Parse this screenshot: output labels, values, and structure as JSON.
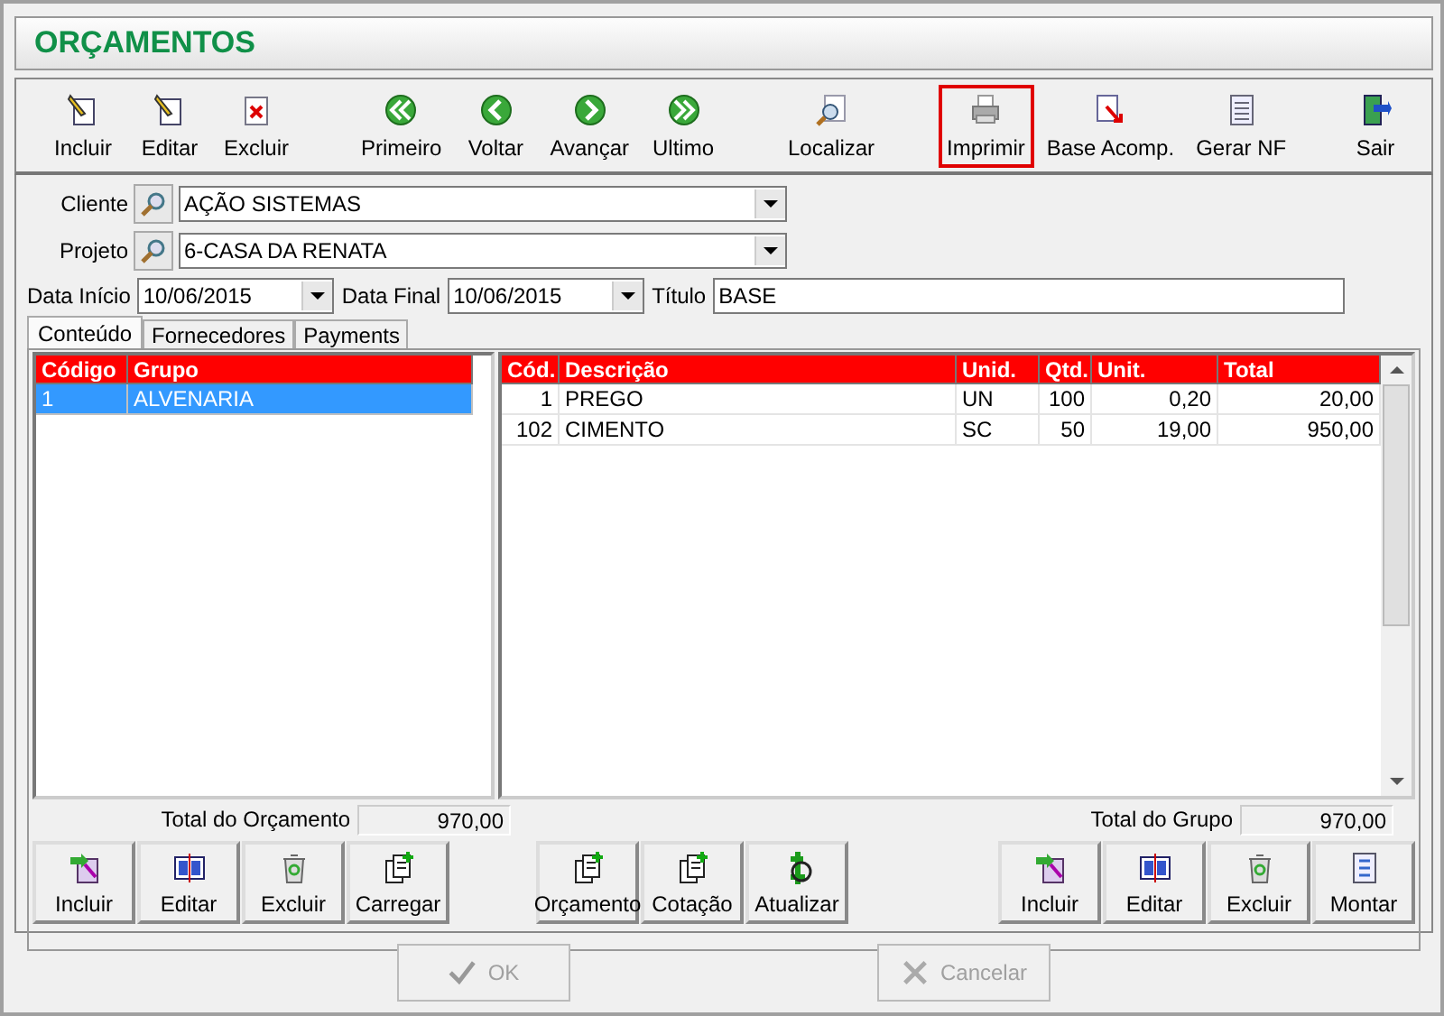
{
  "window": {
    "title": "ORÇAMENTOS"
  },
  "toolbar": [
    [
      {
        "label": "Incluir",
        "highlighted": false
      },
      {
        "label": "Editar",
        "highlighted": false
      },
      {
        "label": "Excluir",
        "highlighted": false
      }
    ],
    [
      {
        "label": "Primeiro",
        "highlighted": false
      },
      {
        "label": "Voltar",
        "highlighted": false
      },
      {
        "label": "Avançar",
        "highlighted": false
      },
      {
        "label": "Ultimo",
        "highlighted": false
      }
    ],
    [
      {
        "label": "Localizar",
        "highlighted": false
      }
    ],
    [
      {
        "label": "Imprimir",
        "highlighted": true
      },
      {
        "label": "Base Acomp.",
        "highlighted": false
      },
      {
        "label": "Gerar NF",
        "highlighted": false
      }
    ],
    [
      {
        "label": "Sair",
        "highlighted": false
      }
    ]
  ],
  "form": {
    "cliente": {
      "label": "Cliente",
      "value": "AÇÃO SISTEMAS"
    },
    "projeto": {
      "label": "Projeto",
      "value": "6-CASA DA RENATA"
    },
    "data_inicio": {
      "label": "Data Início",
      "value": "10/06/2015"
    },
    "data_final": {
      "label": "Data Final",
      "value": "10/06/2015"
    },
    "titulo": {
      "label": "Título",
      "value": "BASE"
    }
  },
  "tabs": [
    {
      "label": "Conteúdo",
      "selected": true
    },
    {
      "label": "Fornecedores",
      "selected": false
    },
    {
      "label": "Payments",
      "selected": false
    }
  ],
  "groups_table": {
    "columns": [
      "Código",
      "Grupo"
    ],
    "rows": [
      {
        "cells": [
          "1",
          "ALVENARIA"
        ],
        "selected": true
      }
    ]
  },
  "items_table": {
    "columns": [
      "Cód.",
      "Descrição",
      "Unid.",
      "Qtd.",
      "Unit.",
      "Total"
    ],
    "rows": [
      {
        "cells": [
          "1",
          "PREGO",
          "UN",
          "100",
          "0,20",
          "20,00"
        ]
      },
      {
        "cells": [
          "102",
          "CIMENTO",
          "SC",
          "50",
          "19,00",
          "950,00"
        ]
      }
    ]
  },
  "total_orcamento": {
    "label": "Total do Orçamento",
    "value": "970,00"
  },
  "total_grupo": {
    "label": "Total do Grupo",
    "value": "970,00"
  },
  "bottom_buttons": [
    [
      "Incluir",
      "Editar",
      "Excluir",
      "Carregar"
    ],
    [
      "Orçamento",
      "Cotação",
      "Atualizar"
    ],
    [
      "Incluir",
      "Editar",
      "Excluir",
      "Montar"
    ]
  ],
  "dialog_buttons": [
    {
      "label": "OK",
      "disabled": true
    },
    {
      "label": "Cancelar",
      "disabled": true
    }
  ]
}
